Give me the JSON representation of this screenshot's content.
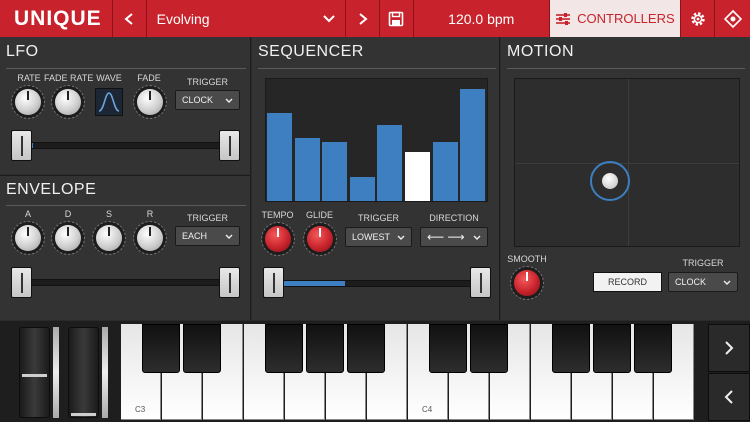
{
  "app": {
    "logo": "UNIQUE",
    "preset_name": "Evolving",
    "bpm": "120.0 bpm",
    "controllers_label": "CONTROLLERS",
    "accent_color": "#c8232c"
  },
  "lfo": {
    "title": "LFO",
    "labels": [
      "RATE",
      "FADE RATE",
      "WAVE",
      "FADE"
    ],
    "trigger_label": "TRIGGER",
    "trigger_value": "CLOCK",
    "slider_level": 0.03
  },
  "envelope": {
    "title": "ENVELOPE",
    "labels": [
      "A",
      "D",
      "S",
      "R"
    ],
    "trigger_label": "TRIGGER",
    "trigger_value": "EACH"
  },
  "sequencer": {
    "title": "SEQUENCER",
    "steps": [
      0.72,
      0.52,
      0.48,
      0.2,
      0.62,
      0.4,
      0.48,
      0.92
    ],
    "active_step": 5,
    "tempo_label": "TEMPO",
    "glide_label": "GLIDE",
    "trigger_label": "TRIGGER",
    "trigger_value": "LOWEST",
    "direction_label": "DIRECTION",
    "direction_value": "⟵ ⟶",
    "slider_level": 0.34
  },
  "motion": {
    "title": "MOTION",
    "smooth_label": "SMOOTH",
    "record_label": "RECORD",
    "trigger_label": "TRIGGER",
    "trigger_value": "CLOCK"
  },
  "keyboard": {
    "octave_labels": [
      "C3",
      "C4"
    ]
  }
}
